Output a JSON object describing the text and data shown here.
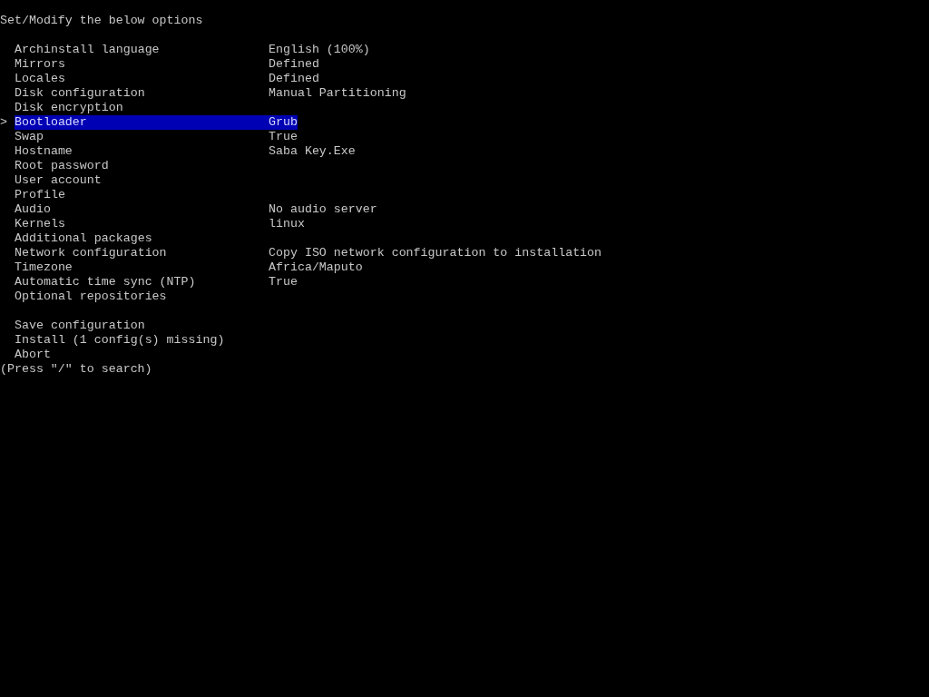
{
  "title": "Set/Modify the below options",
  "cursor": ">",
  "options": [
    {
      "label": "Archinstall language",
      "value": "English (100%)",
      "selected": false
    },
    {
      "label": "Mirrors",
      "value": "Defined",
      "selected": false
    },
    {
      "label": "Locales",
      "value": "Defined",
      "selected": false
    },
    {
      "label": "Disk configuration",
      "value": "Manual Partitioning",
      "selected": false
    },
    {
      "label": "Disk encryption",
      "selected": false
    },
    {
      "label": "Bootloader",
      "value": "Grub",
      "selected": true
    },
    {
      "label": "Swap",
      "value": "True",
      "selected": false
    },
    {
      "label": "Hostname",
      "value": "Saba Key.Exe",
      "selected": false
    },
    {
      "label": "Root password",
      "selected": false
    },
    {
      "label": "User account",
      "selected": false
    },
    {
      "label": "Profile",
      "selected": false
    },
    {
      "label": "Audio",
      "value": "No audio server",
      "selected": false
    },
    {
      "label": "Kernels",
      "value": "linux",
      "selected": false
    },
    {
      "label": "Additional packages",
      "selected": false
    },
    {
      "label": "Network configuration",
      "value": "Copy ISO network configuration to installation",
      "selected": false
    },
    {
      "label": "Timezone",
      "value": "Africa/Maputo",
      "selected": false
    },
    {
      "label": "Automatic time sync (NTP)",
      "value": "True",
      "selected": false
    },
    {
      "label": "Optional repositories",
      "selected": false
    }
  ],
  "actions": [
    {
      "label": "Save configuration",
      "selected": false
    },
    {
      "label": "Install (1 config(s) missing)",
      "selected": false
    },
    {
      "label": "Abort",
      "selected": false
    }
  ],
  "hint": "(Press \"/\" to search)"
}
